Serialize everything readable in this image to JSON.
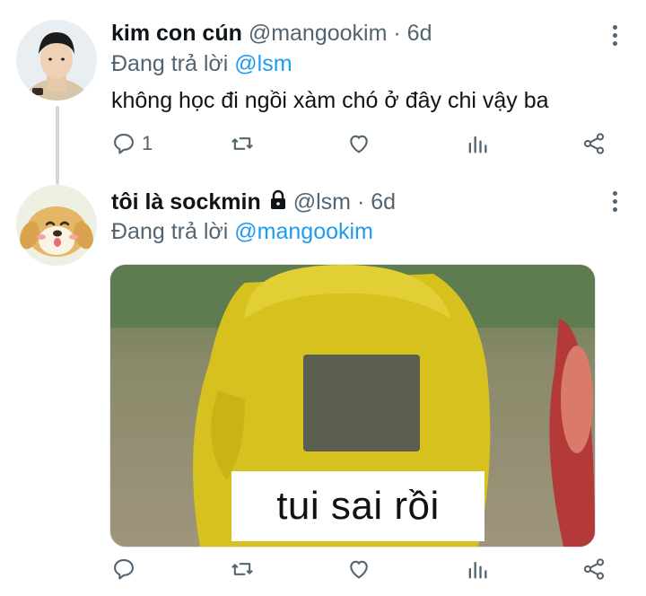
{
  "tweets": [
    {
      "name": "kim con cún",
      "handle": "@mangookim",
      "dot": "·",
      "time": "6d",
      "reply_prefix": "Đang trả lời",
      "reply_mention": "@lsm",
      "text": "không học đi ngồi xàm chó ở đây chi vậy ba",
      "reply_count": "1",
      "avatar_icon": "user-photo-avatar"
    },
    {
      "name": "tôi là sockmin",
      "handle": "@lsm",
      "dot": "·",
      "time": "6d",
      "reply_prefix": "Đang trả lời",
      "reply_mention": "@mangookim",
      "media_caption": "tui sai rồi",
      "reply_count": "",
      "avatar_icon": "dog-cartoon-avatar",
      "protected_icon": "lock-icon"
    }
  ],
  "colors": {
    "text": "#0f1419",
    "secondary": "#536471",
    "link": "#1d9bf0",
    "thread_line": "#cfd9de"
  }
}
